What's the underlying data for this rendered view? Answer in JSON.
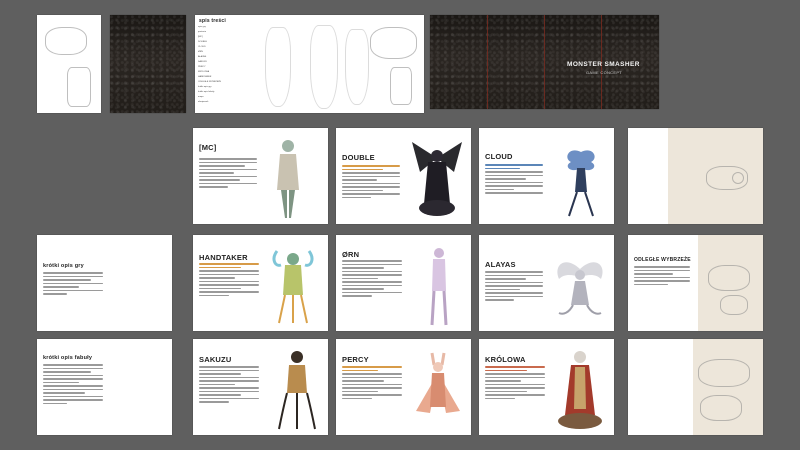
{
  "toc": {
    "title": "spis treści",
    "items": [
      "opis gry",
      "postacie",
      "[MC]",
      "DOUBLE",
      "CLOUD",
      "ØRN",
      "ALAYAS",
      "SAKUZU",
      "PERCY",
      "KRÓLOWA",
      "HANDTAKER",
      "ODLEGŁE WYBRZEŻE",
      "krótki opis gry",
      "krótki opis fabuły",
      "mapa",
      "ekwipunek"
    ]
  },
  "cover": {
    "title": "MONSTER SMASHER",
    "subtitle": "GAME CONCEPT"
  },
  "pages": {
    "mc": "[MC]",
    "double": "DOUBLE",
    "cloud": "CLOUD",
    "handtaker": "HANDTAKER",
    "orn": "ØRN",
    "alayas": "ALAYAS",
    "odlegle": "ODLEGŁE WYBRZEŻE",
    "sakuzu": "SAKUZU",
    "percy": "PERCY",
    "krolowa": "KRÓLOWA",
    "opis_gry": "krótki opis gry",
    "opis_fabuly": "krótki opis fabuły"
  },
  "colors": {
    "background": "#5f5f5f",
    "accent_orange": "#d79b48",
    "accent_blue": "#5b86b8",
    "accent_red": "#c96a4d"
  }
}
